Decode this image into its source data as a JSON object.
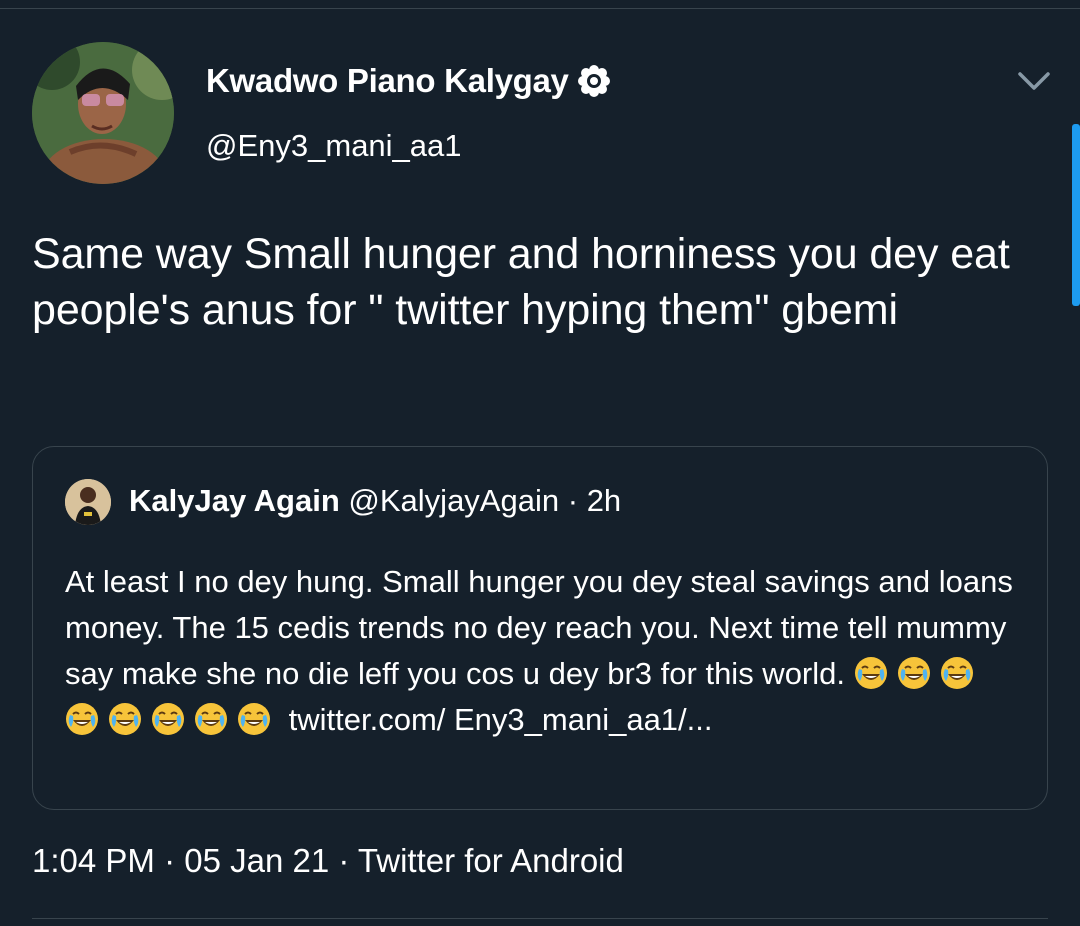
{
  "tweet": {
    "author": {
      "display_name": "Kwadwo Piano Kalygay",
      "handle": "@Eny3_mani_aa1",
      "verified_icon": "verified-badge-icon"
    },
    "menu_icon": "chevron-down-icon",
    "text": "Same way Small hunger and horniness you dey eat people's anus for \" twitter hyping them\" gbemi",
    "quoted_tweet": {
      "author": {
        "display_name": "KalyJay Again",
        "handle": "@KalyjayAgain",
        "separator": "·",
        "time_ago": "2h"
      },
      "text": "At least I no dey hung. Small hunger you dey steal savings and loans money. The 15 cedis trends no dey reach you. Next time tell mummy say make she no die leff you cos u dey br3 for this world.",
      "emoji": "😂😂😂😂😂😂😂😂",
      "emoji_icon": "face-with-tears-of-joy-icon",
      "link_text": "twitter.com/ Eny3_mani_aa1/..."
    },
    "timestamp": "1:04 PM · 05 Jan 21 · Twitter for Android"
  },
  "colors": {
    "background": "#15202b",
    "divider": "#38444d",
    "scrollbar": "#1d9bf0",
    "text": "#ffffff"
  }
}
